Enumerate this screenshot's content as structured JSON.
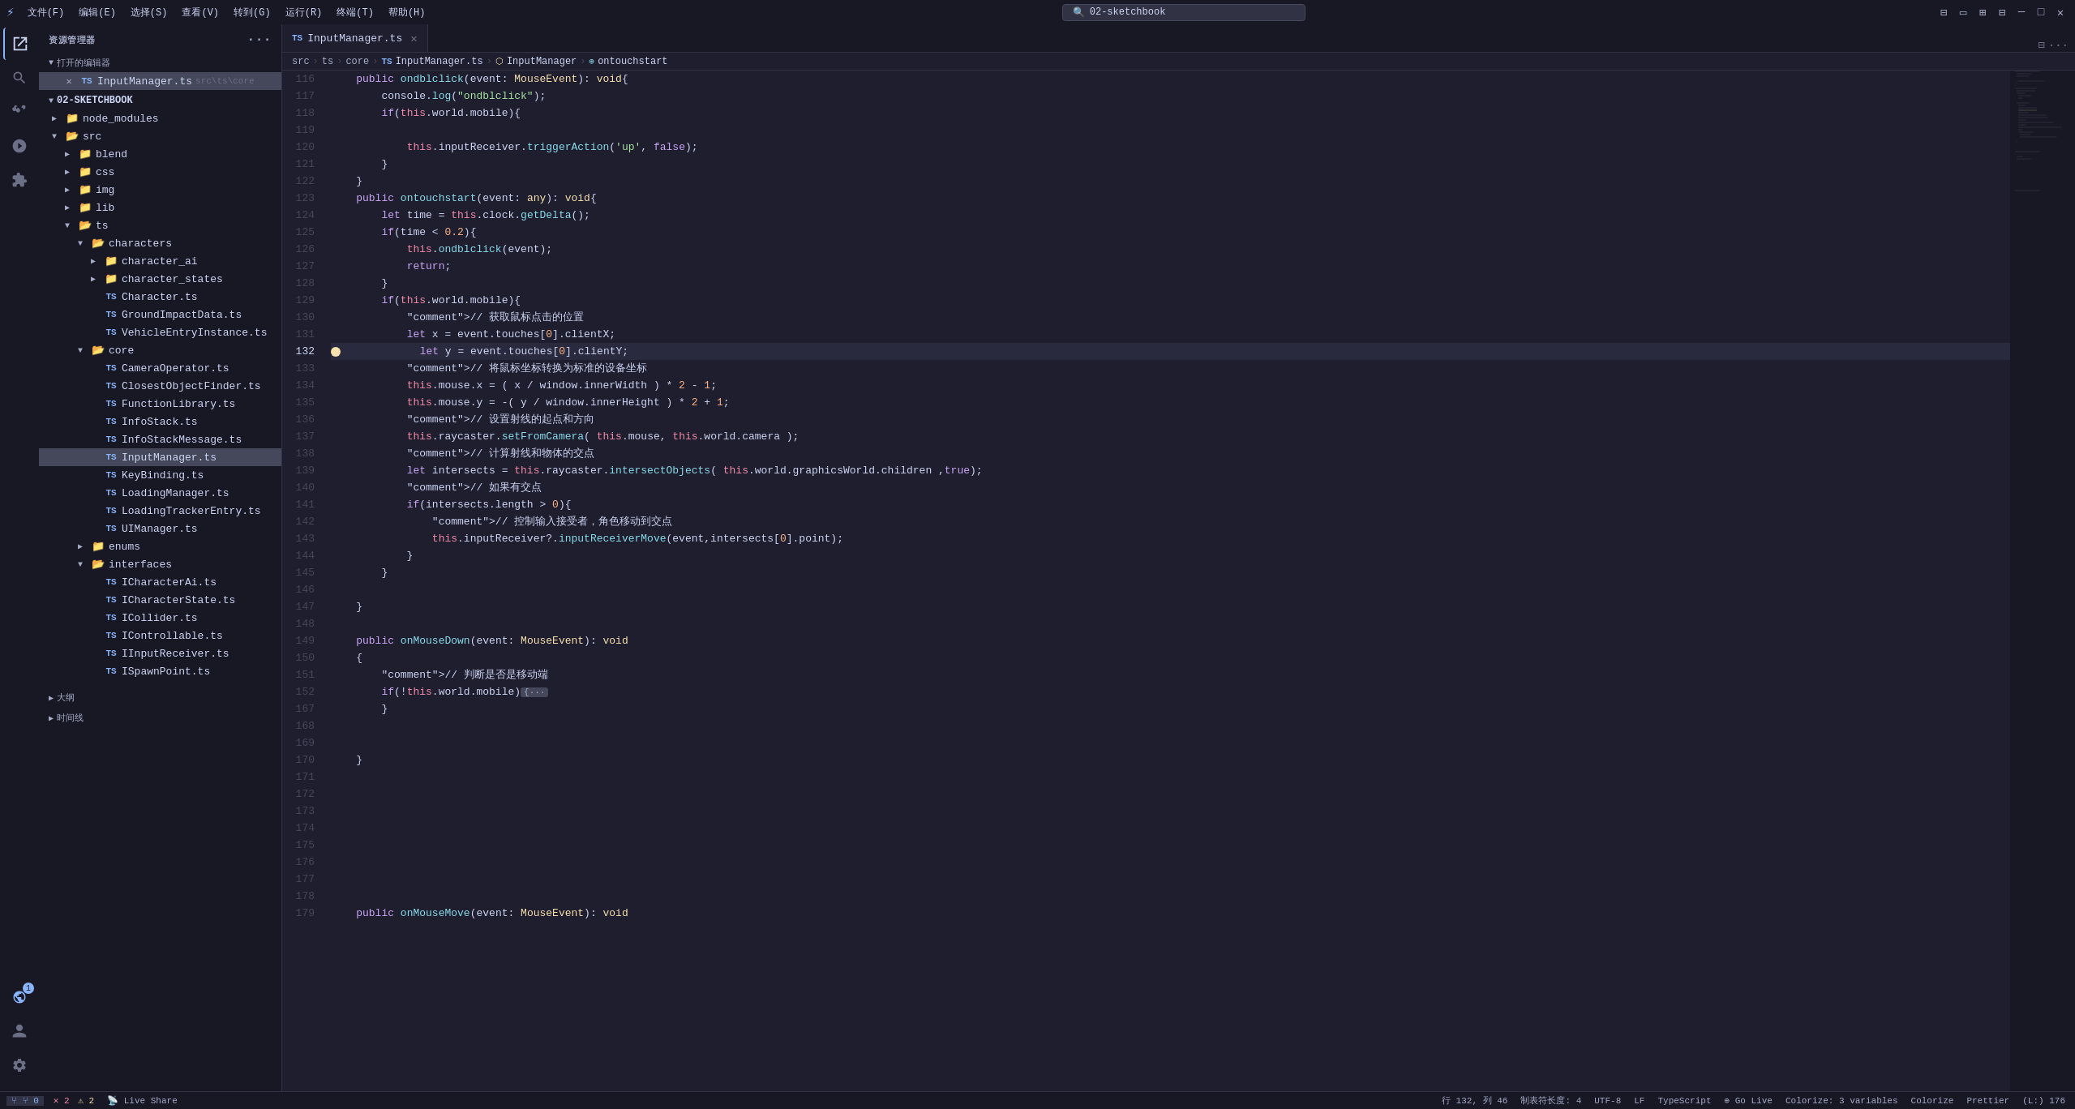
{
  "titleBar": {
    "appIcon": "⚡",
    "menus": [
      "文件(F)",
      "编辑(E)",
      "选择(S)",
      "查看(V)",
      "转到(G)",
      "运行(R)",
      "终端(T)",
      "帮助(H)"
    ],
    "searchPlaceholder": "02-sketchbook",
    "controls": [
      "─",
      "□",
      "✕"
    ]
  },
  "activityBar": {
    "icons": [
      {
        "name": "explorer-icon",
        "symbol": "⎘"
      },
      {
        "name": "search-icon",
        "symbol": "🔍"
      },
      {
        "name": "source-control-icon",
        "symbol": "⑂"
      },
      {
        "name": "run-debug-icon",
        "symbol": "▷"
      },
      {
        "name": "extensions-icon",
        "symbol": "⊞"
      }
    ],
    "bottomIcons": [
      {
        "name": "remote-icon",
        "symbol": "⊗"
      },
      {
        "name": "account-icon",
        "symbol": "👤"
      },
      {
        "name": "settings-icon",
        "symbol": "⚙"
      }
    ]
  },
  "sidebar": {
    "title": "资源管理器",
    "openEditors": "打开的编辑器",
    "activeFile": "InputManager.ts",
    "activePath": "src\\ts\\core",
    "projectName": "02-SKETCHBOOK",
    "tree": [
      {
        "indent": 0,
        "type": "folder",
        "label": "node_modules",
        "expanded": false
      },
      {
        "indent": 0,
        "type": "folder",
        "label": "src",
        "expanded": true
      },
      {
        "indent": 1,
        "type": "folder",
        "label": "blend",
        "expanded": false
      },
      {
        "indent": 1,
        "type": "folder",
        "label": "css",
        "expanded": false
      },
      {
        "indent": 1,
        "type": "folder",
        "label": "img",
        "expanded": false
      },
      {
        "indent": 1,
        "type": "folder",
        "label": "lib",
        "expanded": false
      },
      {
        "indent": 1,
        "type": "folder",
        "label": "ts",
        "expanded": true
      },
      {
        "indent": 2,
        "type": "folder",
        "label": "characters",
        "expanded": true
      },
      {
        "indent": 3,
        "type": "folder",
        "label": "character_ai",
        "expanded": false
      },
      {
        "indent": 3,
        "type": "folder",
        "label": "character_states",
        "expanded": false
      },
      {
        "indent": 3,
        "type": "file",
        "label": "Character.ts",
        "ext": "ts"
      },
      {
        "indent": 3,
        "type": "file",
        "label": "GroundImpactData.ts",
        "ext": "ts"
      },
      {
        "indent": 3,
        "type": "file",
        "label": "VehicleEntryInstance.ts",
        "ext": "ts"
      },
      {
        "indent": 2,
        "type": "folder",
        "label": "core",
        "expanded": true
      },
      {
        "indent": 3,
        "type": "file",
        "label": "CameraOperator.ts",
        "ext": "ts"
      },
      {
        "indent": 3,
        "type": "file",
        "label": "ClosestObjectFinder.ts",
        "ext": "ts"
      },
      {
        "indent": 3,
        "type": "file",
        "label": "FunctionLibrary.ts",
        "ext": "ts"
      },
      {
        "indent": 3,
        "type": "file",
        "label": "InfoStack.ts",
        "ext": "ts"
      },
      {
        "indent": 3,
        "type": "file",
        "label": "InfoStackMessage.ts",
        "ext": "ts"
      },
      {
        "indent": 3,
        "type": "file",
        "label": "InputManager.ts",
        "ext": "ts",
        "active": true
      },
      {
        "indent": 3,
        "type": "file",
        "label": "KeyBinding.ts",
        "ext": "ts"
      },
      {
        "indent": 3,
        "type": "file",
        "label": "LoadingManager.ts",
        "ext": "ts"
      },
      {
        "indent": 3,
        "type": "file",
        "label": "LoadingTrackerEntry.ts",
        "ext": "ts"
      },
      {
        "indent": 3,
        "type": "file",
        "label": "UIManager.ts",
        "ext": "ts"
      },
      {
        "indent": 2,
        "type": "folder",
        "label": "enums",
        "expanded": false
      },
      {
        "indent": 2,
        "type": "folder",
        "label": "interfaces",
        "expanded": true
      },
      {
        "indent": 3,
        "type": "file",
        "label": "ICharacterAi.ts",
        "ext": "ts"
      },
      {
        "indent": 3,
        "type": "file",
        "label": "ICharacterState.ts",
        "ext": "ts"
      },
      {
        "indent": 3,
        "type": "file",
        "label": "ICollider.ts",
        "ext": "ts"
      },
      {
        "indent": 3,
        "type": "file",
        "label": "IControllable.ts",
        "ext": "ts"
      },
      {
        "indent": 3,
        "type": "file",
        "label": "IInputReceiver.ts",
        "ext": "ts"
      },
      {
        "indent": 3,
        "type": "file",
        "label": "ISpawnPoint.ts",
        "ext": "ts"
      }
    ],
    "bottomSections": [
      {
        "label": "大纲"
      },
      {
        "label": "时间线"
      }
    ]
  },
  "tabs": [
    {
      "label": "InputManager.ts",
      "ext": "ts",
      "active": true,
      "modified": false
    }
  ],
  "breadcrumb": {
    "parts": [
      "src",
      ">",
      "ts",
      ">",
      "core",
      ">",
      "InputManager.ts",
      ">",
      "InputManager",
      ">",
      "ontouchstart"
    ]
  },
  "code": {
    "startLine": 116,
    "activeLine": 132,
    "debugLine": 132,
    "lines": [
      {
        "num": 116,
        "content": "    public ondblclick(event: MouseEvent): void{"
      },
      {
        "num": 117,
        "content": "        console.log(\"ondblclick\");"
      },
      {
        "num": 118,
        "content": "        if(this.world.mobile){"
      },
      {
        "num": 119,
        "content": ""
      },
      {
        "num": 120,
        "content": "            this.inputReceiver.triggerAction('up', false);"
      },
      {
        "num": 121,
        "content": "        }"
      },
      {
        "num": 122,
        "content": "    }"
      },
      {
        "num": 123,
        "content": "    public ontouchstart(event: any): void{"
      },
      {
        "num": 124,
        "content": "        let time = this.clock.getDelta();"
      },
      {
        "num": 125,
        "content": "        if(time < 0.2){"
      },
      {
        "num": 126,
        "content": "            this.ondblclick(event);"
      },
      {
        "num": 127,
        "content": "            return;"
      },
      {
        "num": 128,
        "content": "        }"
      },
      {
        "num": 129,
        "content": "        if(this.world.mobile){"
      },
      {
        "num": 130,
        "content": "            // 获取鼠标点击的位置"
      },
      {
        "num": 131,
        "content": "            let x = event.touches[0].clientX;"
      },
      {
        "num": 132,
        "content": "            let y = event.touches[0].clientY;",
        "debug": true,
        "highlight": true
      },
      {
        "num": 133,
        "content": "            // 将鼠标坐标转换为标准的设备坐标"
      },
      {
        "num": 134,
        "content": "            this.mouse.x = ( x / window.innerWidth ) * 2 - 1;"
      },
      {
        "num": 135,
        "content": "            this.mouse.y = -( y / window.innerHeight ) * 2 + 1;"
      },
      {
        "num": 136,
        "content": "            // 设置射线的起点和方向"
      },
      {
        "num": 137,
        "content": "            this.raycaster.setFromCamera( this.mouse, this.world.camera );"
      },
      {
        "num": 138,
        "content": "            // 计算射线和物体的交点"
      },
      {
        "num": 139,
        "content": "            let intersects = this.raycaster.intersectObjects( this.world.graphicsWorld.children ,true);"
      },
      {
        "num": 140,
        "content": "            // 如果有交点"
      },
      {
        "num": 141,
        "content": "            if(intersects.length > 0){"
      },
      {
        "num": 142,
        "content": "                // 控制输入接受者，角色移动到交点"
      },
      {
        "num": 143,
        "content": "                this.inputReceiver?.inputReceiverMove(event,intersects[0].point);"
      },
      {
        "num": 144,
        "content": "            }"
      },
      {
        "num": 145,
        "content": "        }"
      },
      {
        "num": 146,
        "content": ""
      },
      {
        "num": 147,
        "content": "    }"
      },
      {
        "num": 148,
        "content": ""
      },
      {
        "num": 149,
        "content": "    public onMouseDown(event: MouseEvent): void"
      },
      {
        "num": 150,
        "content": "    {"
      },
      {
        "num": 151,
        "content": "        // 判断是否是移动端"
      },
      {
        "num": 152,
        "content": "        if(!this.world.mobile){···",
        "collapsed": true
      },
      {
        "num": 167,
        "content": "        }"
      },
      {
        "num": 168,
        "content": ""
      },
      {
        "num": 169,
        "content": ""
      },
      {
        "num": 170,
        "content": "    }"
      },
      {
        "num": 171,
        "content": ""
      },
      {
        "num": 172,
        "content": ""
      },
      {
        "num": 173,
        "content": ""
      },
      {
        "num": 174,
        "content": ""
      },
      {
        "num": 175,
        "content": ""
      },
      {
        "num": 176,
        "content": ""
      },
      {
        "num": 177,
        "content": ""
      },
      {
        "num": 178,
        "content": ""
      },
      {
        "num": 179,
        "content": "    public onMouseMove(event: MouseEvent): void"
      }
    ]
  },
  "statusBar": {
    "errors": "2",
    "warnings": "2",
    "git": "⑂ 0",
    "bell": "🔔 0",
    "liveShare": "Live Share",
    "position": "(L:) 176",
    "selection": "行 132, 列 46",
    "indent": "制表符长度: 4",
    "encoding": "UTF-8",
    "lineEnding": "LF",
    "language": "TypeScript",
    "goLive": "Go Live",
    "variables": "Colorize: 3 variables",
    "colorize": "Colorize",
    "prettier": "Prettier"
  }
}
